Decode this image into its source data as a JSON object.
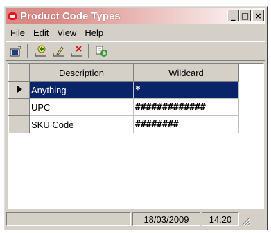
{
  "window": {
    "title": "Product Code Types",
    "buttons": {
      "minimize": "_",
      "maximize": "□",
      "close": "×"
    }
  },
  "menu": [
    {
      "label": "File",
      "accel": "F",
      "rest": "ile"
    },
    {
      "label": "Edit",
      "accel": "E",
      "rest": "dit"
    },
    {
      "label": "View",
      "accel": "V",
      "rest": "iew"
    },
    {
      "label": "Help",
      "accel": "H",
      "rest": "elp"
    }
  ],
  "toolbar": {
    "icons": [
      "open-icon",
      "add-icon",
      "edit-icon",
      "delete-icon",
      "refresh-icon"
    ]
  },
  "grid": {
    "columns": [
      "Description",
      "Wildcard"
    ],
    "rows": [
      {
        "description": "Anything",
        "wildcard": "*",
        "selected": true
      },
      {
        "description": "UPC",
        "wildcard": "#############",
        "selected": false
      },
      {
        "description": "SKU Code",
        "wildcard": "########",
        "selected": false
      }
    ]
  },
  "status": {
    "date": "18/03/2009",
    "time": "14:20"
  },
  "colors": {
    "selection": "#0a246a",
    "window_bg": "#d4d0c8",
    "title_accent": "#e8161b"
  }
}
